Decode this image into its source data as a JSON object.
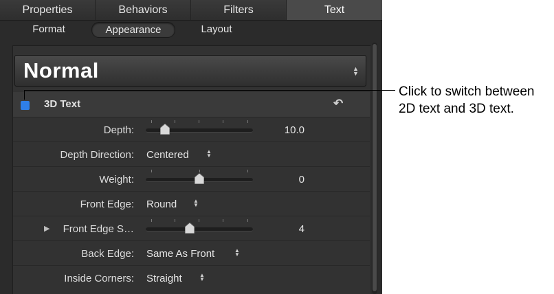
{
  "tabs": [
    "Properties",
    "Behaviors",
    "Filters",
    "Text"
  ],
  "subtabs": [
    "Format",
    "Appearance",
    "Layout"
  ],
  "preset": {
    "label": "Normal"
  },
  "section": {
    "title": "3D Text",
    "checkbox_color": "#2f7fe8"
  },
  "rows": {
    "depth": {
      "label": "Depth:",
      "value": "10.0",
      "slider_fraction": 0.15
    },
    "depth_direction": {
      "label": "Depth Direction:",
      "value": "Centered"
    },
    "weight": {
      "label": "Weight:",
      "value": "0",
      "slider_fraction": 0.5
    },
    "front_edge": {
      "label": "Front Edge:",
      "value": "Round"
    },
    "front_edge_size": {
      "label": "Front Edge S…",
      "value": "4",
      "slider_fraction": 0.4
    },
    "back_edge": {
      "label": "Back Edge:",
      "value": "Same As Front"
    },
    "inside_corners": {
      "label": "Inside Corners:",
      "value": "Straight"
    }
  },
  "callout": {
    "line1": "Click to switch between",
    "line2": "2D text and 3D text."
  },
  "colors": {
    "accent": "#2f7fe8",
    "panel": "#2b2b2b"
  }
}
